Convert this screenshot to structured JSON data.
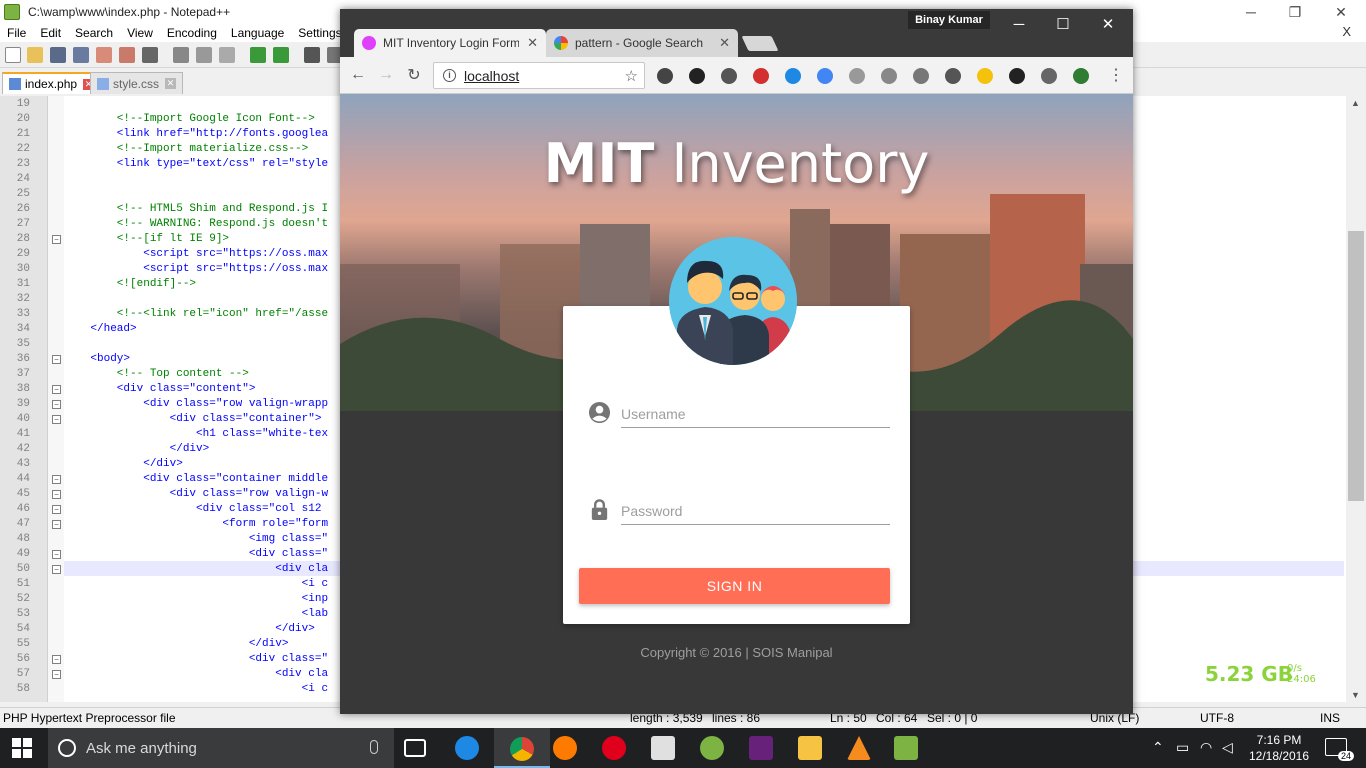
{
  "npp": {
    "title": "C:\\wamp\\www\\index.php - Notepad++",
    "menu": [
      "File",
      "Edit",
      "Search",
      "View",
      "Encoding",
      "Language",
      "Settings"
    ],
    "menu_close": "X",
    "tabs": [
      "index.php",
      "style.css"
    ],
    "lines": [
      {
        "n": "19",
        "t": ""
      },
      {
        "n": "20",
        "t": "        <!--Import Google Icon Font-->",
        "c": "cm"
      },
      {
        "n": "21",
        "t": "        <link href=\"http://fonts.googlea"
      },
      {
        "n": "22",
        "t": "        <!--Import materialize.css-->",
        "c": "cm"
      },
      {
        "n": "23",
        "t": "        <link type=\"text/css\" rel=\"style"
      },
      {
        "n": "24",
        "t": ""
      },
      {
        "n": "25",
        "t": ""
      },
      {
        "n": "26",
        "t": "        <!-- HTML5 Shim and Respond.js I",
        "c": "cm"
      },
      {
        "n": "27",
        "t": "        <!-- WARNING: Respond.js doesn't",
        "c": "cm"
      },
      {
        "n": "28",
        "t": "        <!--[if lt IE 9]>",
        "c": "cm"
      },
      {
        "n": "29",
        "t": "            <script src=\"https://oss.max"
      },
      {
        "n": "30",
        "t": "            <script src=\"https://oss.max"
      },
      {
        "n": "31",
        "t": "        <![endif]-->",
        "c": "cm"
      },
      {
        "n": "32",
        "t": ""
      },
      {
        "n": "33",
        "t": "        <!--<link rel=\"icon\" href=\"/asse",
        "c": "cm"
      },
      {
        "n": "34",
        "t": "    </head>"
      },
      {
        "n": "35",
        "t": ""
      },
      {
        "n": "36",
        "t": "    <body>"
      },
      {
        "n": "37",
        "t": "        <!-- Top content -->",
        "c": "cm"
      },
      {
        "n": "38",
        "t": "        <div class=\"content\">"
      },
      {
        "n": "39",
        "t": "            <div class=\"row valign-wrapp"
      },
      {
        "n": "40",
        "t": "                <div class=\"container\">"
      },
      {
        "n": "41",
        "t": "                    <h1 class=\"white-tex"
      },
      {
        "n": "42",
        "t": "                </div>"
      },
      {
        "n": "43",
        "t": "            </div>"
      },
      {
        "n": "44",
        "t": "            <div class=\"container middle"
      },
      {
        "n": "45",
        "t": "                <div class=\"row valign-w"
      },
      {
        "n": "46",
        "t": "                    <div class=\"col s12"
      },
      {
        "n": "47",
        "t": "                        <form role=\"form"
      },
      {
        "n": "48",
        "t": "                            <img class=\""
      },
      {
        "n": "49",
        "t": "                            <div class=\""
      },
      {
        "n": "50",
        "t": "                                <div cla"
      },
      {
        "n": "51",
        "t": "                                    <i c"
      },
      {
        "n": "52",
        "t": "                                    <inp"
      },
      {
        "n": "53",
        "t": "                                    <lab"
      },
      {
        "n": "54",
        "t": "                                </div>"
      },
      {
        "n": "55",
        "t": "                            </div>"
      },
      {
        "n": "56",
        "t": "                            <div class=\""
      },
      {
        "n": "57",
        "t": "                                <div cla"
      },
      {
        "n": "58",
        "t": "                                    <i c"
      }
    ],
    "status": {
      "filetype": "PHP Hypertext Preprocessor file",
      "length": "length : 3,539",
      "lines": "lines : 86",
      "ln": "Ln : 50",
      "col": "Col : 64",
      "sel": "Sel : 0 | 0",
      "eol": "Unix (LF)",
      "enc": "UTF-8",
      "mode": "INS"
    }
  },
  "chrome": {
    "user": "Binay Kumar",
    "tabs": [
      {
        "title": "MIT Inventory Login Form",
        "color": "#e040fb"
      },
      {
        "title": "pattern - Google Search",
        "color": "#4285f4"
      }
    ],
    "address": "localhost",
    "extensions": [
      "incognito-icon",
      "color-wheel-icon",
      "gear-icon",
      "adblock-icon",
      "drive-icon",
      "translate-icon",
      "cloud-icon",
      "feather-icon",
      "bulb-icon",
      "speed-icon",
      "idea-icon",
      "pacman-icon",
      "film-icon",
      "download-icon"
    ]
  },
  "page": {
    "title_bold": "MIT",
    "title_light": " Inventory",
    "username_placeholder": "Username",
    "password_placeholder": "Password",
    "signin": "SIGN IN",
    "copyright": "Copyright © 2016 | SOIS Manipal",
    "accent": "#ff6e55"
  },
  "taskbar": {
    "search": "Ask me anything",
    "time": "7:16 PM",
    "date": "12/18/2016",
    "notifications": "24"
  },
  "widget": {
    "size": "5.23 GB",
    "rate": "0/s",
    "time": "24:06"
  }
}
